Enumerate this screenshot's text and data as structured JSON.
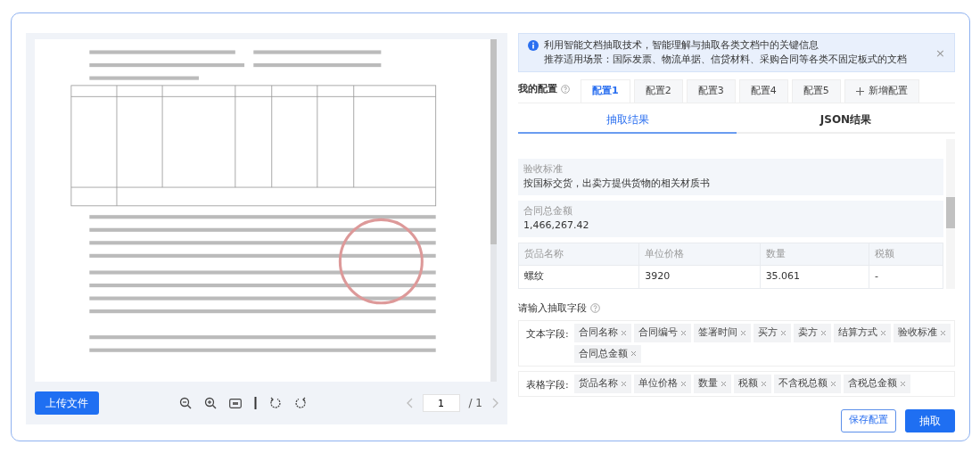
{
  "viewer": {
    "upload_button": "上传文件",
    "page": "1",
    "total": "/ 1"
  },
  "notice": {
    "lines": [
      "利用智能文档抽取技术，智能理解与抽取各类文档中的关键信息",
      "推荐适用场景：国际发票、物流单据、信贷材料、采购合同等各类不固定板式的文档"
    ],
    "close": "×"
  },
  "configs": {
    "label": "我的配置",
    "tabs": [
      {
        "label": "配置1",
        "selected": true
      },
      {
        "label": "配置2",
        "selected": false
      },
      {
        "label": "配置3",
        "selected": false
      },
      {
        "label": "配置4",
        "selected": false
      },
      {
        "label": "配置5",
        "selected": false
      }
    ],
    "add_label": "新增配置"
  },
  "result_tabs": [
    {
      "label": "抽取结果",
      "selected": true
    },
    {
      "label": "JSON结果",
      "selected": false
    }
  ],
  "results": {
    "fields": [
      {
        "label": "验收标准",
        "value": "按国标交货，出卖方提供货物的相关材质书"
      },
      {
        "label": "合同总金额",
        "value": "1,466,267.42"
      }
    ],
    "table": {
      "columns": [
        "货品名称",
        "单位价格",
        "数量",
        "税额"
      ],
      "rows": [
        [
          "螺纹",
          "3920",
          "35.061",
          "-"
        ]
      ]
    }
  },
  "field_input": {
    "label": "请输入抽取字段",
    "groups": [
      {
        "label": "文本字段:",
        "tags": [
          "合同名称",
          "合同编号",
          "签署时间",
          "买方",
          "卖方",
          "结算方式",
          "验收标准",
          "合同总金额"
        ]
      },
      {
        "label": "表格字段:",
        "tags": [
          "货品名称",
          "单位价格",
          "数量",
          "税额",
          "不含税总额",
          "含税总金额"
        ]
      }
    ]
  },
  "buttons": [
    {
      "label": "保存配置",
      "kind": "outline"
    },
    {
      "label": "抽取",
      "kind": "primary"
    }
  ]
}
